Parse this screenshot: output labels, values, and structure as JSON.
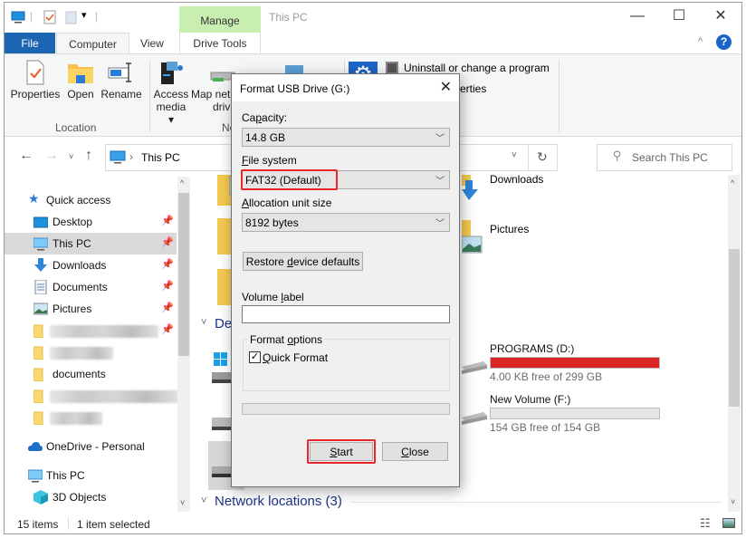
{
  "window": {
    "title": "This PC",
    "context_tab": "Manage",
    "controls": {
      "minimize": "—",
      "maximize": "☐",
      "close": "✕"
    }
  },
  "tabs": [
    {
      "label": "File"
    },
    {
      "label": "Computer"
    },
    {
      "label": "View"
    },
    {
      "label": "Drive Tools"
    }
  ],
  "ribbon": {
    "location_group": {
      "label": "Location",
      "buttons": [
        {
          "label": "Properties"
        },
        {
          "label": "Open"
        },
        {
          "label": "Rename"
        }
      ]
    },
    "network_group": {
      "label_partial": "Ne",
      "buttons": [
        {
          "label": "Access",
          "label2": "media ▾"
        },
        {
          "label": "Map net",
          "label2": "drive"
        }
      ]
    },
    "system_group": {
      "items": [
        {
          "label": "Uninstall or change a program"
        },
        {
          "label": "erties"
        }
      ]
    }
  },
  "address": {
    "path": "This PC",
    "separator": "›",
    "search_placeholder": "Search This PC"
  },
  "nav": {
    "quick_access": "Quick access",
    "items": [
      {
        "label": "Desktop",
        "icon": "desktop-icon",
        "pinned": true
      },
      {
        "label": "This PC",
        "icon": "this-pc-icon",
        "pinned": true,
        "selected": true
      },
      {
        "label": "Downloads",
        "icon": "downloads-icon",
        "pinned": true
      },
      {
        "label": "Documents",
        "icon": "documents-icon",
        "pinned": true
      },
      {
        "label": "Pictures",
        "icon": "pictures-icon",
        "pinned": true
      }
    ],
    "folders": [
      {
        "label": ""
      },
      {
        "label": ""
      },
      {
        "label": "documents"
      },
      {
        "label": ""
      },
      {
        "label": ""
      }
    ],
    "onedrive": "OneDrive - Personal",
    "this_pc": "This PC",
    "objects_3d": "3D Objects"
  },
  "content": {
    "folders": [
      {
        "label": "Downloads"
      },
      {
        "label": "Pictures"
      }
    ],
    "devices_section": "Devices and drives",
    "devices_section_partial": "Dev",
    "drives": [
      {
        "name": "PROGRAMS (D:)",
        "free": "4.00 KB free of 299 GB",
        "used_fraction": 1.0,
        "bar_color": "#da2626"
      },
      {
        "name": "New Volume (F:)",
        "free": "154 GB free of 154 GB",
        "used_fraction": 0.0,
        "bar_color": "#26a0da"
      }
    ],
    "network_section": "Network locations (3)"
  },
  "status": {
    "items": "15 items",
    "selected": "1 item selected"
  },
  "dialog": {
    "title": "Format USB Drive (G:)",
    "capacity_label": "Capacity:",
    "capacity_value": "14.8 GB",
    "fs_label": "File system",
    "fs_value": "FAT32 (Default)",
    "alloc_label": "Allocation unit size",
    "alloc_value": "8192 bytes",
    "restore_button": "Restore device defaults",
    "volume_label": "Volume label",
    "volume_value": "",
    "format_options": "Format options",
    "quick_format": "Quick Format",
    "quick_format_checked": true,
    "progress": 0,
    "start_button": "Start",
    "close_button": "Close",
    "highlight_color": "#e8262b"
  }
}
